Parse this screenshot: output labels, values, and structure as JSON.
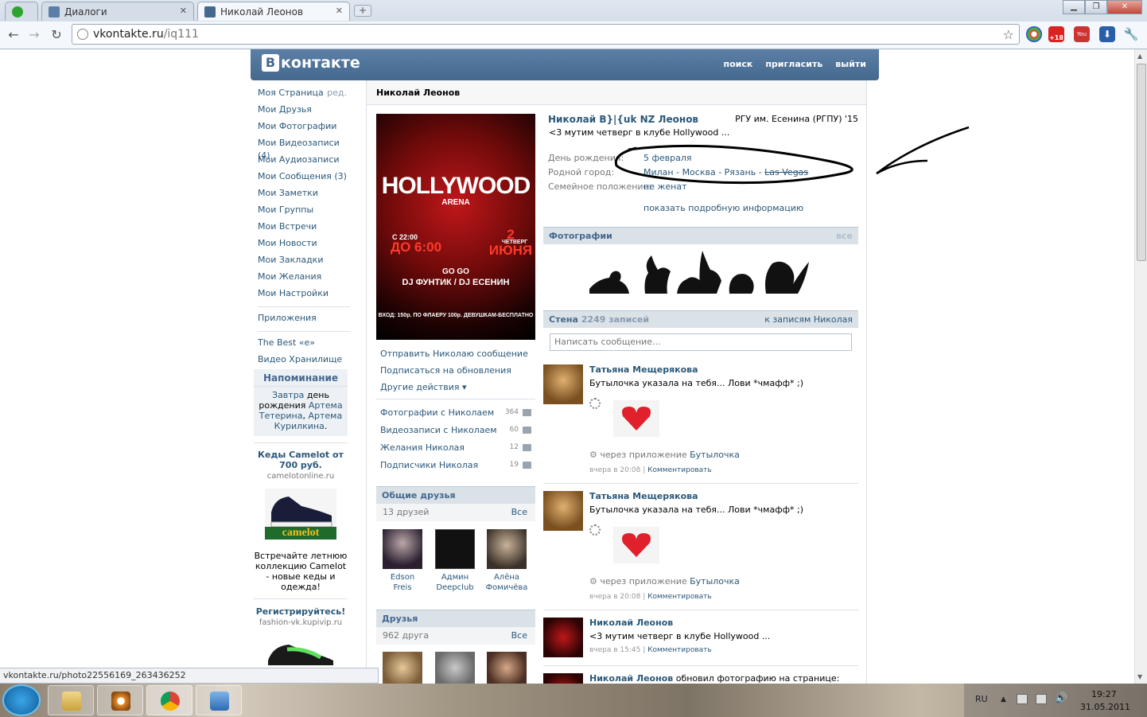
{
  "browser": {
    "tabs": [
      {
        "label": "",
        "type": "pinned-app"
      },
      {
        "label": "Диалоги"
      },
      {
        "label": "Николай Леонов",
        "active": true
      }
    ],
    "url_host": "vkontakte.ru",
    "url_path": "/iq111",
    "extensions": [
      "color-wheel-icon",
      "age-18-icon",
      "youtube-icon",
      "download-icon",
      "wrench-icon"
    ]
  },
  "vk": {
    "logo_letter": "В",
    "logo_text": "контакте",
    "nav": [
      "поиск",
      "пригласить",
      "выйти"
    ],
    "left_menu": [
      "Моя Страница",
      "Мои Друзья",
      "Мои Фотографии",
      "Мои Видеозаписи",
      "Мои Аудиозаписи",
      "Мои Сообщения",
      "Мои Заметки",
      "Мои Группы",
      "Мои Встречи",
      "Мои Новости",
      "Мои Закладки",
      "Мои Желания",
      "Мои Настройки"
    ],
    "left_menu_counts": {
      "videos": "(4)",
      "messages": "(3)"
    },
    "edit_label": "ред.",
    "apps": [
      "Приложения",
      "The Best «e»",
      "Видео Хранилище"
    ],
    "reminder": {
      "title": "Напоминание",
      "p1": "Завтра",
      "p2": " день рождения ",
      "p3": "Артема Тетерина",
      "p4": ", ",
      "p5": "Артема Курилкина",
      "p6": "."
    },
    "ads": [
      {
        "title": "Кеды Camelot от 700 руб.",
        "source": "camelotonline.ru",
        "text": "Встречайте летнюю коллекцию Camelot - новые кеды и одежда!",
        "brand": "camelot"
      },
      {
        "title": "Регистрируйтесь!",
        "source": "fashion-vk.kupivip.ru"
      }
    ],
    "page_title": "Николай Леонов",
    "poster": {
      "title": "HOLLYWOOD",
      "subtitle": "ARENA",
      "time_from": "С 22:00",
      "time_to": "ДО 6:00",
      "date": "2 ИЮНЯ",
      "weekday": "ЧЕТВЕРГ",
      "gogo": "GO GO",
      "djs": "DJ ФУНТИК / DJ ЕСЕНИН",
      "price": "ВХОД: 150р. ПО ФЛАЕРУ 100р. ДЕВУШКАМ-БЕСПЛАТНО"
    },
    "actions": [
      "Отправить Николаю сообщение",
      "Подписаться на обновления",
      "Другие действия"
    ],
    "counters": [
      {
        "label": "Фотографии с Николаем",
        "count": "364"
      },
      {
        "label": "Видеозаписи с Николаем",
        "count": "60"
      },
      {
        "label": "Желания Николая",
        "count": "12"
      },
      {
        "label": "Подписчики Николая",
        "count": "19"
      }
    ],
    "common_friends": {
      "title": "Общие друзья",
      "count": "13 друзей",
      "all": "Все",
      "people": [
        {
          "name1": "Edson",
          "name2": "Freis"
        },
        {
          "name1": "Админ",
          "name2": "Deepclub"
        },
        {
          "name1": "Алёна",
          "name2": "Фомичёва"
        }
      ]
    },
    "friends": {
      "title": "Друзья",
      "count": "962 друга",
      "all": "Все"
    },
    "profile": {
      "name": "Николай B}|{uk NZ Леонов",
      "status": "<3 мутим четверг в клубе Hollywood ...",
      "university": "РГУ им. Есенина (РГПУ) '15",
      "birthday_label": "День рождения:",
      "birthday": "5 февраля",
      "hometown_label": "Родной город:",
      "hometown": "Милан - Москва - Рязань - ",
      "hometown_strike": "Las Vegas",
      "family_label": "Семейное положение:",
      "family": "не женат",
      "more": "показать подробную информацию"
    },
    "photos": {
      "title": "Фотографии",
      "all": "все"
    },
    "wall": {
      "title": "Стена",
      "count": "2249 записей",
      "link": "к записям Николая",
      "placeholder": "Написать сообщение...",
      "posts": [
        {
          "author": "Татьяна Мещерякова",
          "text": "Бутылочка указала на тебя... Лови *чмафф* ;)",
          "via": "через приложение ",
          "app": "Бутылочка",
          "time": "вчера в 20:08",
          "comment": "Комментировать"
        },
        {
          "author": "Татьяна Мещерякова",
          "text": "Бутылочка указала на тебя... Лови *чмафф* ;)",
          "via": "через приложение ",
          "app": "Бутылочка",
          "time": "вчера в 20:08",
          "comment": "Комментировать"
        },
        {
          "author": "Николай Леонов",
          "text": "<3 мутим четверг в клубе Hollywood ...",
          "time": "вчера в 15:45",
          "comment": "Комментировать"
        },
        {
          "author": "Николай Леонов",
          "text": " обновил фотографию на странице:"
        }
      ]
    }
  },
  "status_bar_url": "vkontakte.ru/photo22556169_263436252",
  "taskbar": {
    "lang": "RU",
    "time": "19:27",
    "date": "31.05.2011"
  }
}
